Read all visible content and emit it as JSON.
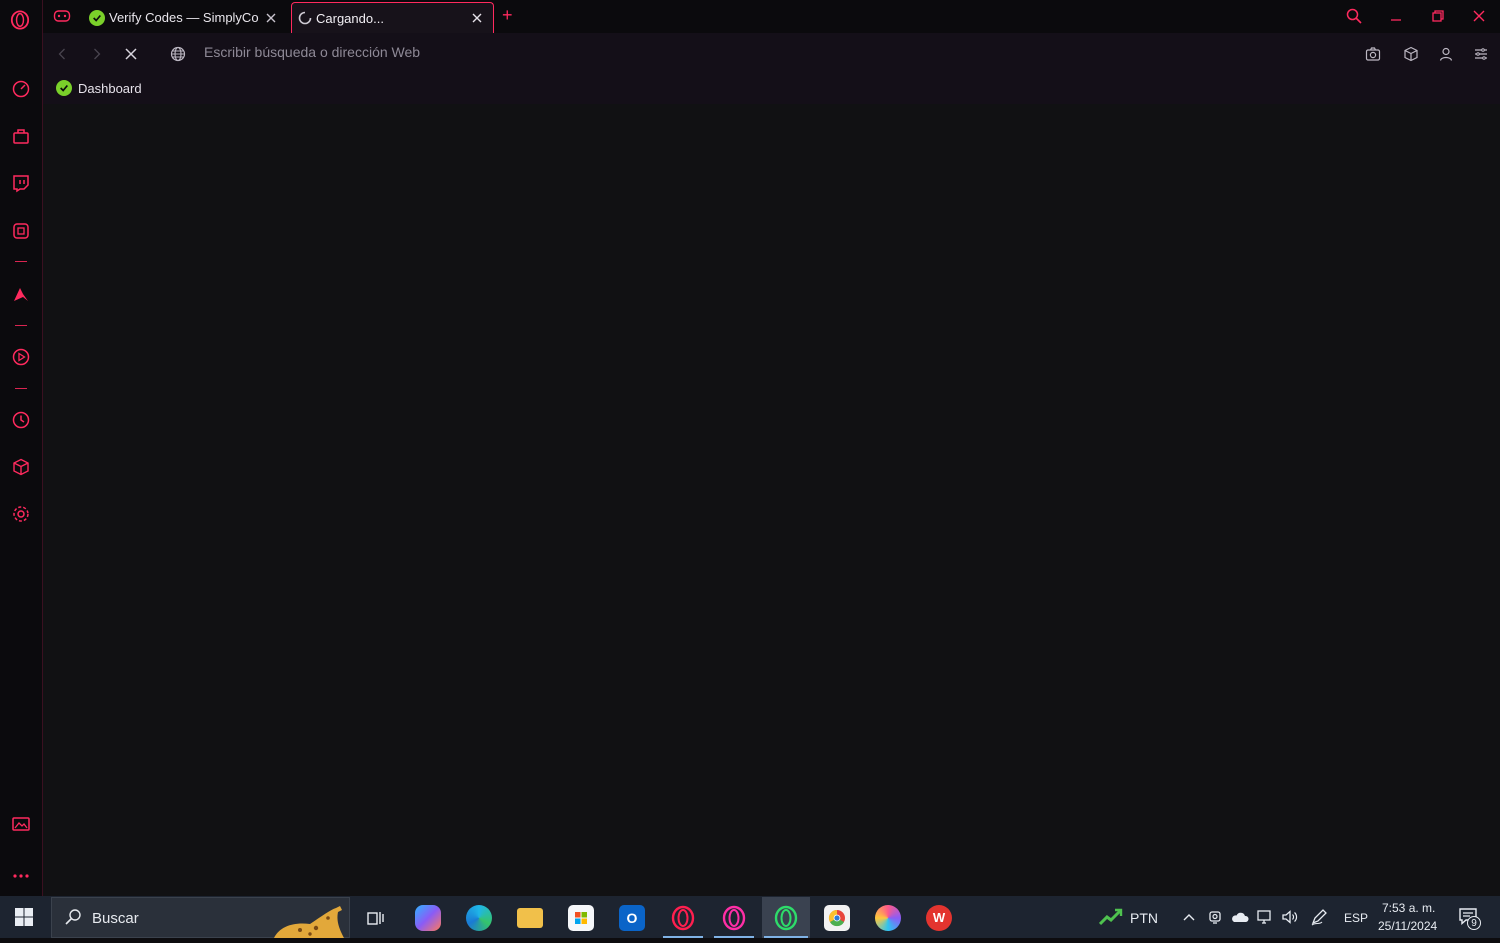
{
  "window": {
    "tabs": [
      {
        "title": "Verify Codes — SimplyCodes",
        "favicon": "simplycodes-icon"
      },
      {
        "title": "Cargando...",
        "favicon": "loading-spinner-icon",
        "active": true
      }
    ],
    "new_tab_symbol": "+"
  },
  "toolbar": {
    "address_placeholder": "Escribir búsqueda o dirección Web"
  },
  "bookmarks": [
    {
      "label": "Dashboard",
      "icon": "simplycodes-icon"
    }
  ],
  "sidebar": {
    "items": [
      "speed-dial-icon",
      "shop-icon",
      "twitch-icon",
      "extensions-icon",
      "aria-icon",
      "player-icon",
      "history-icon",
      "cube-icon",
      "settings-icon",
      "gallery-icon",
      "more-icon"
    ]
  },
  "taskbar": {
    "search_placeholder": "Buscar",
    "stock_ticker": "PTN",
    "language": "ESP",
    "time": "7:53 a. m.",
    "date": "25/11/2024",
    "notification_count": "9"
  },
  "colors": {
    "accent": "#ff2a5e",
    "background": "#111113",
    "toolbar": "#140f18",
    "taskbar": "#1d2430"
  }
}
